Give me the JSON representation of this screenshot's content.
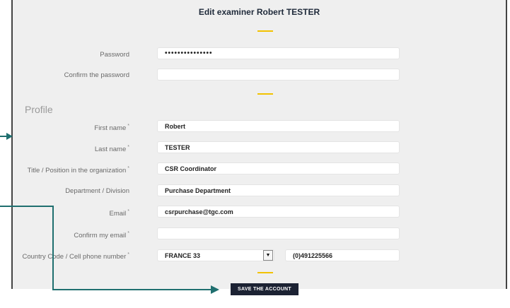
{
  "header": {
    "title": "Edit examiner Robert TESTER"
  },
  "section": {
    "profile_title": "Profile"
  },
  "form": {
    "password": {
      "label": "Password",
      "value": "•••••••••••••••"
    },
    "confirm_password": {
      "label": "Confirm the password",
      "value": ""
    },
    "first_name": {
      "label": "First name",
      "value": "Robert",
      "required": "*"
    },
    "last_name": {
      "label": "Last name",
      "value": "TESTER",
      "required": "*"
    },
    "title_position": {
      "label": "Title / Position in the organization",
      "value": "CSR Coordinator",
      "required": "*"
    },
    "department": {
      "label": "Department / Division",
      "value": "Purchase Department"
    },
    "email": {
      "label": "Email",
      "value": "csrpurchase@tgc.com",
      "required": "*"
    },
    "confirm_email": {
      "label": "Confirm my email",
      "value": "",
      "required": "*"
    },
    "country_phone": {
      "label": "Country Code / Cell phone number",
      "required": "*",
      "country_selected": "FRANCE 33",
      "phone": "(0)491225566"
    }
  },
  "actions": {
    "save_label": "SAVE THE ACCOUNT"
  },
  "colors": {
    "accent_dash": "#f2c200",
    "annotation_arrow": "#1f6f6f",
    "button_bg": "#1c2233"
  }
}
